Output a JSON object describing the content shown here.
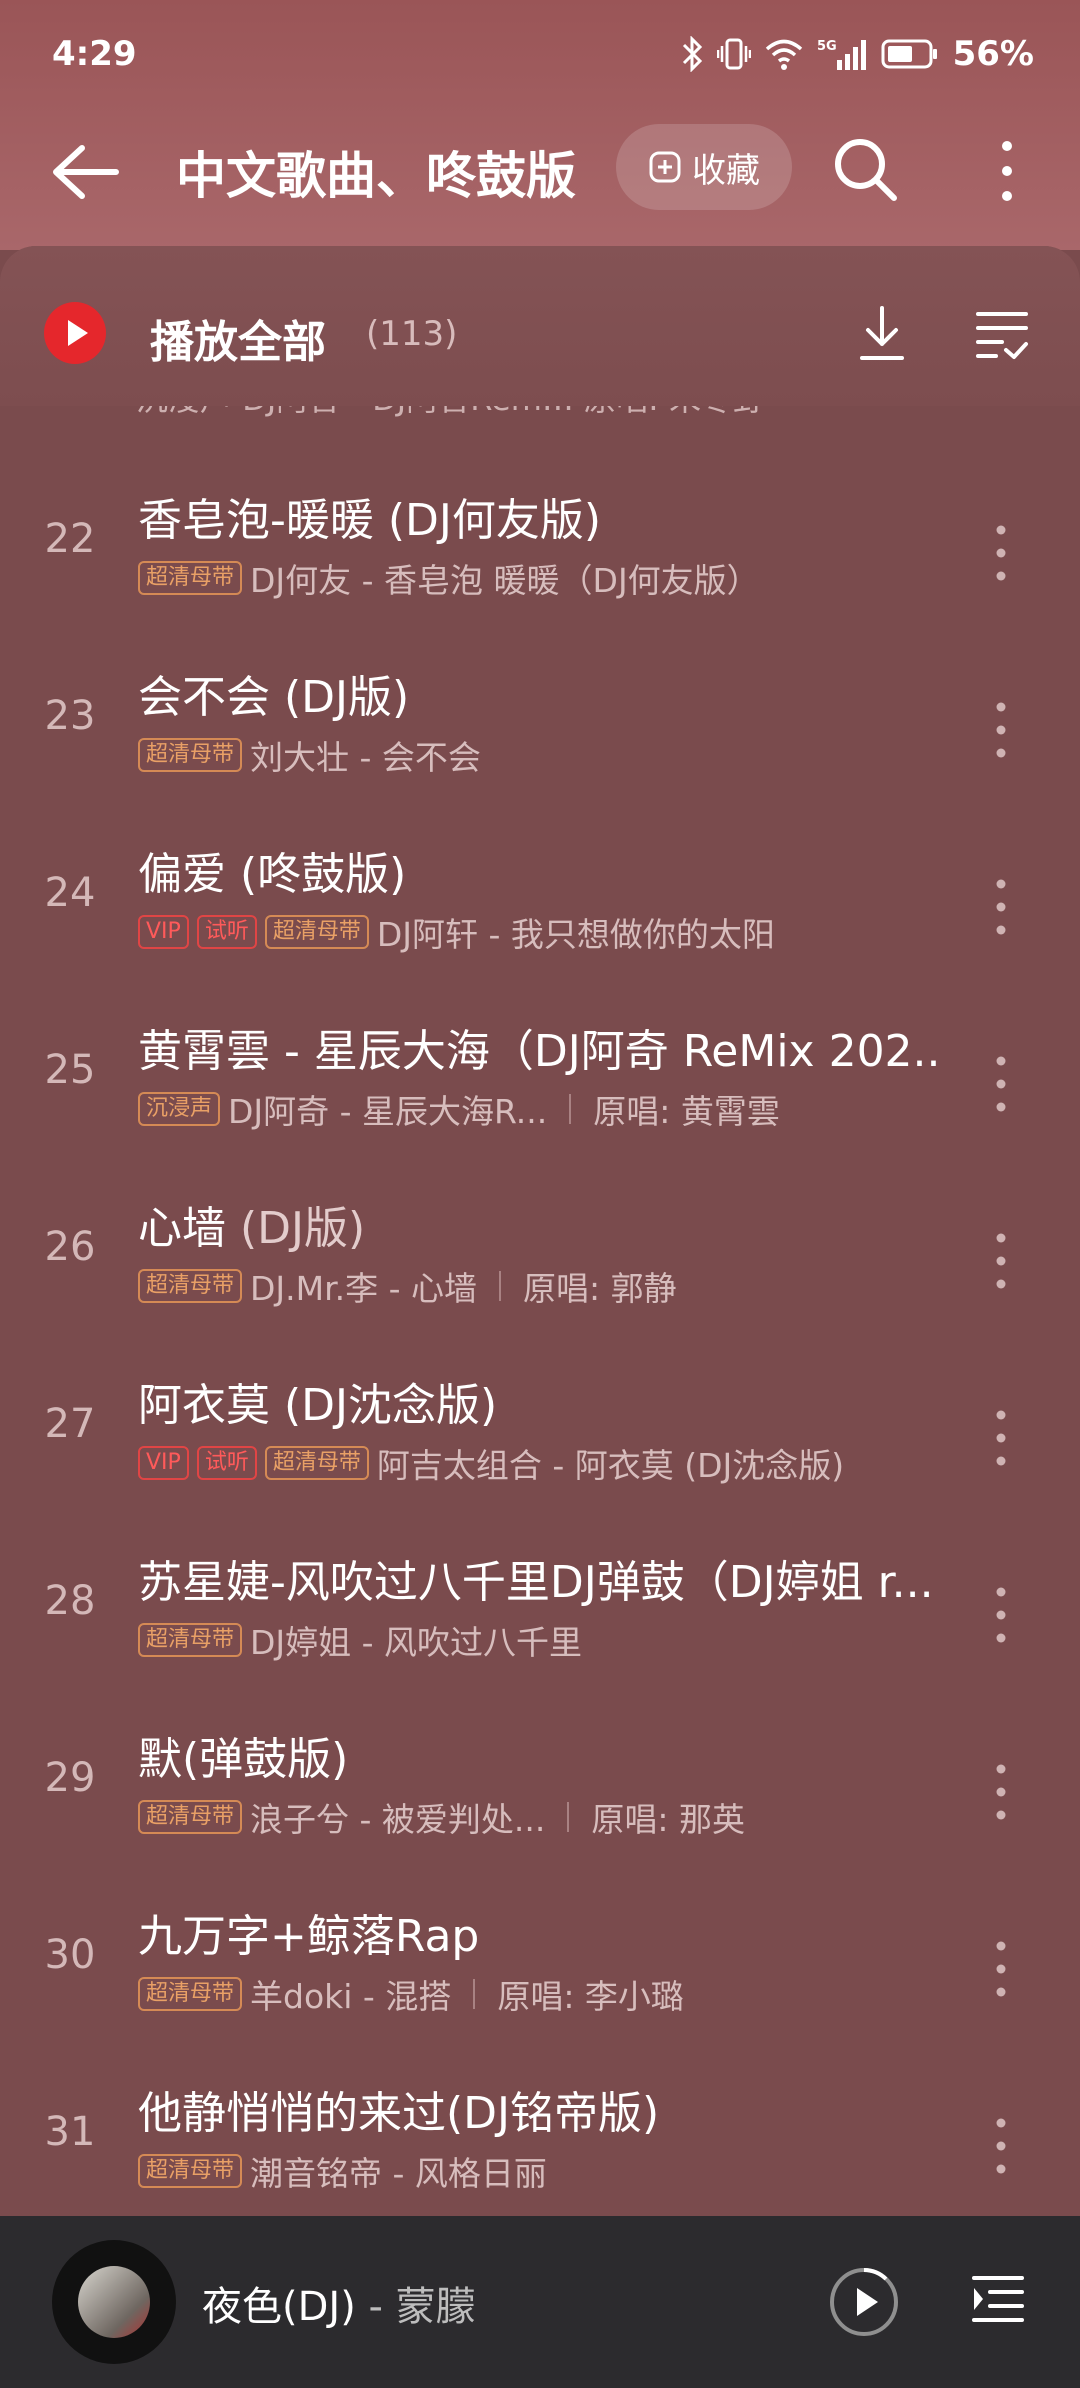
{
  "status_bar": {
    "time": "4:29",
    "battery_percent": "56%"
  },
  "nav": {
    "title": "中文歌曲、咚鼓版",
    "favorite_label": "收藏"
  },
  "list_header": {
    "play_all_label": "播放全部",
    "count": "(113)"
  },
  "partial_row_text": "沉浸声 DJ阿音 - DJ阿音Rem…  原唱: 朱冬野",
  "songs": [
    {
      "index": "22",
      "title": "香皂泡-暖暖 (DJ何友版)",
      "title_suffix": "",
      "tags": [
        "超清母带"
      ],
      "artist_album": "DJ何友 - 香皂泡 暖暖（DJ何友版）",
      "original": ""
    },
    {
      "index": "23",
      "title": "会不会 (DJ版)",
      "title_suffix": "",
      "tags": [
        "超清母带"
      ],
      "artist_album": "刘大壮 - 会不会",
      "original": ""
    },
    {
      "index": "24",
      "title": "偏爱 (咚鼓版)",
      "title_suffix": "",
      "tags": [
        "VIP",
        "试听",
        "超清母带"
      ],
      "artist_album": "DJ阿轩 - 我只想做你的太阳",
      "original": ""
    },
    {
      "index": "25",
      "title": "黄霄雲 - 星辰大海（DJ阿奇 ReMix 202...",
      "title_suffix": "",
      "tags": [
        "沉浸声"
      ],
      "artist_album": "DJ阿奇 - 星辰大海R...",
      "original": "原唱: 黄霄雲"
    },
    {
      "index": "26",
      "title": "心墙",
      "title_suffix": " (DJ版)",
      "tags": [
        "超清母带"
      ],
      "artist_album": "DJ.Mr.李 - 心墙",
      "original": "原唱: 郭静"
    },
    {
      "index": "27",
      "title": "阿衣莫 (DJ沈念版)",
      "title_suffix": "",
      "tags": [
        "VIP",
        "试听",
        "超清母带"
      ],
      "artist_album": "阿吉太组合 - 阿衣莫 (DJ沈念版)",
      "original": ""
    },
    {
      "index": "28",
      "title": "苏星婕-风吹过八千里DJ弹鼓（DJ婷姐 r...",
      "title_suffix": "",
      "tags": [
        "超清母带"
      ],
      "artist_album": "DJ婷姐 - 风吹过八千里",
      "original": ""
    },
    {
      "index": "29",
      "title": "默(弹鼓版)",
      "title_suffix": "",
      "tags": [
        "超清母带"
      ],
      "artist_album": "浪子兮 - 被爱判处...",
      "original": "原唱: 那英"
    },
    {
      "index": "30",
      "title": "九万字+鲸落Rap",
      "title_suffix": "",
      "tags": [
        "超清母带"
      ],
      "artist_album": "羊doki - 混搭",
      "original": "原唱: 李小璐"
    },
    {
      "index": "31",
      "title": "他静悄悄的来过(DJ铭帝版)",
      "title_suffix": "",
      "tags": [
        "超清母带"
      ],
      "artist_album": "潮音铭帝 - 风格日丽",
      "original": ""
    }
  ],
  "player": {
    "track": "夜色(DJ)",
    "artist": " - 蒙朦"
  },
  "colors": {
    "top_bar": "#a25d60",
    "list_bg": "#7a4b4d",
    "accent_red": "#e5272c",
    "player_bg": "#2c2b2e"
  }
}
